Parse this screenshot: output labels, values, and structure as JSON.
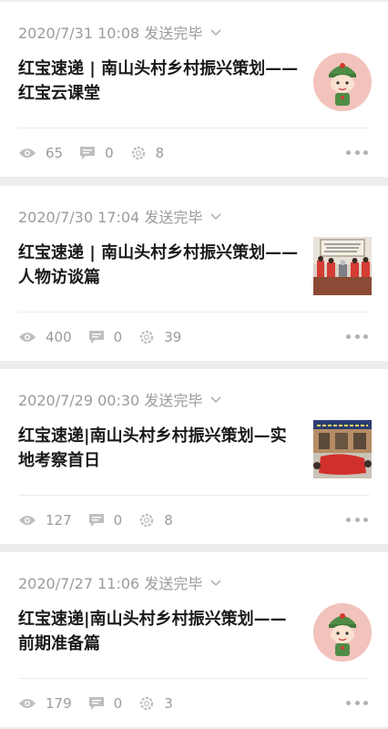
{
  "articles": [
    {
      "meta": "2020/7/31 10:08 发送完毕",
      "title": "红宝速递 | 南山头村乡村振兴策划——红宝云课堂",
      "thumb_icon": "mascot-avatar-icon",
      "stats": {
        "views": "65",
        "comments": "0",
        "likes": "8"
      }
    },
    {
      "meta": "2020/7/30 17:04 发送完毕",
      "title": "红宝速递 | 南山头村乡村振兴策划——人物访谈篇",
      "thumb_icon": "photo-thumbnail",
      "stats": {
        "views": "400",
        "comments": "0",
        "likes": "39"
      }
    },
    {
      "meta": "2020/7/29 00:30 发送完毕",
      "title": "红宝速递|南山头村乡村振兴策划—实地考察首日",
      "thumb_icon": "photo-thumbnail",
      "stats": {
        "views": "127",
        "comments": "0",
        "likes": "8"
      }
    },
    {
      "meta": "2020/7/27 11:06 发送完毕",
      "title": "红宝速递|南山头村乡村振兴策划——前期准备篇",
      "thumb_icon": "mascot-avatar-icon",
      "stats": {
        "views": "179",
        "comments": "0",
        "likes": "3"
      }
    }
  ],
  "colors": {
    "meta_text": "#9b9b9b",
    "title_text": "#1a1a1a",
    "background": "#ededed",
    "card": "#ffffff"
  }
}
